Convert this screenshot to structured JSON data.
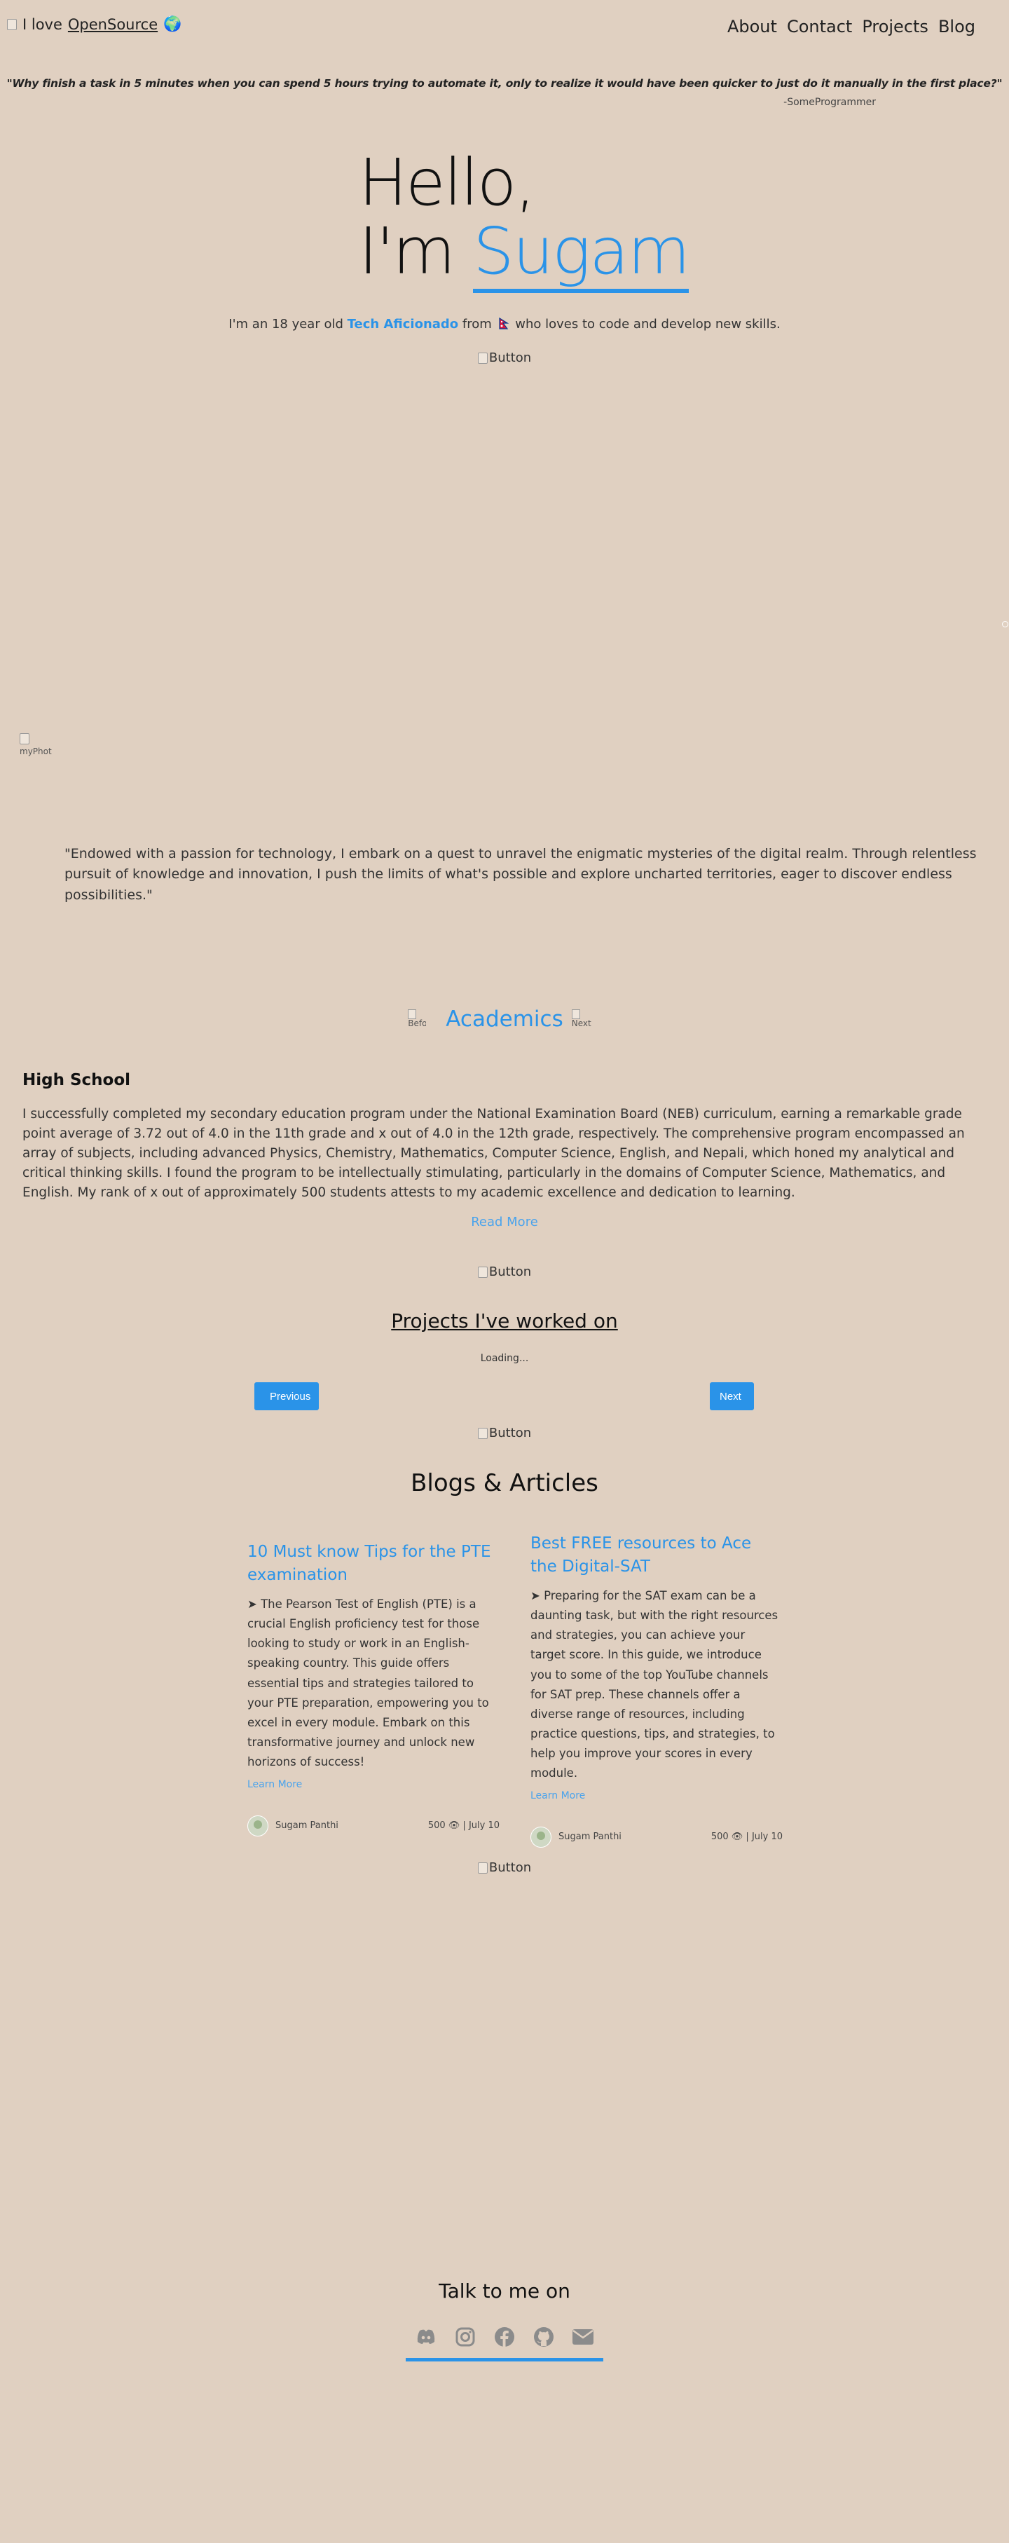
{
  "header": {
    "logo_alt": "",
    "brand_prefix": "I love",
    "brand_link": "OpenSource",
    "brand_emoji": "🌍",
    "nav": [
      "About",
      "Contact",
      "Projects",
      "Blog"
    ]
  },
  "quote": {
    "text": "\"Why finish a task in 5 minutes when you can spend 5 hours trying to automate it, only to realize it would have been quicker to just do it manually in the first place?\"",
    "author": "-SomeProgrammer"
  },
  "hero": {
    "hello": "Hello,",
    "im": "I'm",
    "name": "Sugam",
    "intro_prefix": "I'm an 18 year old",
    "intro_accent": "Tech Aficionado",
    "intro_from": "from",
    "intro_suffix": "who loves to code and develop new skills.",
    "button_alt": "Button"
  },
  "about": {
    "photo_alt": "myPhoto",
    "quote": "\"Endowed with a passion for technology, I embark on a quest to unravel the enigmatic mysteries of the digital realm. Through relentless pursuit of knowledge and innovation, I push the limits of what's possible and explore uncharted territories, eager to discover endless possibilities.\""
  },
  "academics": {
    "before_alt": "Before",
    "title": "Academics",
    "next_alt": "Next",
    "section_title": "High School",
    "text": "I successfully completed my secondary education program under the National Examination Board (NEB) curriculum, earning a remarkable grade point average of 3.72 out of 4.0 in the 11th grade and x out of 4.0 in the 12th grade, respectively. The comprehensive program encompassed an array of subjects, including advanced Physics, Chemistry, Mathematics, Computer Science, English, and Nepali, which honed my analytical and critical thinking skills. I found the program to be intellectually stimulating, particularly in the domains of Computer Science, Mathematics, and English. My rank of x out of approximately 500 students attests to my academic excellence and dedication to learning.",
    "read_more": "Read More",
    "button_alt": "Button"
  },
  "projects": {
    "title": "Projects I've worked on",
    "loading": "Loading...",
    "previous": "Previous",
    "next": "Next",
    "button_alt": "Button"
  },
  "blogs": {
    "title": "Blogs & Articles",
    "cards": [
      {
        "title": "10 Must know Tips for the PTE examination",
        "body": "➤ The Pearson Test of English (PTE) is a crucial English proficiency test for those looking to study or work in an English-speaking country. This guide offers essential tips and strategies tailored to your PTE preparation, empowering you to excel in every module. Embark on this transformative journey and unlock new horizons of success!",
        "learn_more": "Learn More",
        "author": "Sugam Panthi",
        "stats": "500 👁 | July 10"
      },
      {
        "title": "Best FREE resources to Ace the Digital-SAT",
        "body": "➤ Preparing for the SAT exam can be a daunting task, but with the right resources and strategies, you can achieve your target score. In this guide, we introduce you to some of the top YouTube channels for SAT prep. These channels offer a diverse range of resources, including practice questions, tips, and strategies, to help you improve your scores in every module.",
        "learn_more": "Learn More",
        "author": "Sugam Panthi",
        "stats": "500 👁 | July 10"
      }
    ],
    "button_alt": "Button"
  },
  "contact": {
    "title": "Talk to me on",
    "icons": [
      "discord-icon",
      "instagram-icon",
      "facebook-icon",
      "github-icon",
      "email-icon"
    ]
  },
  "colors": {
    "background": "#e0d0c1",
    "accent": "#2a93e8"
  }
}
